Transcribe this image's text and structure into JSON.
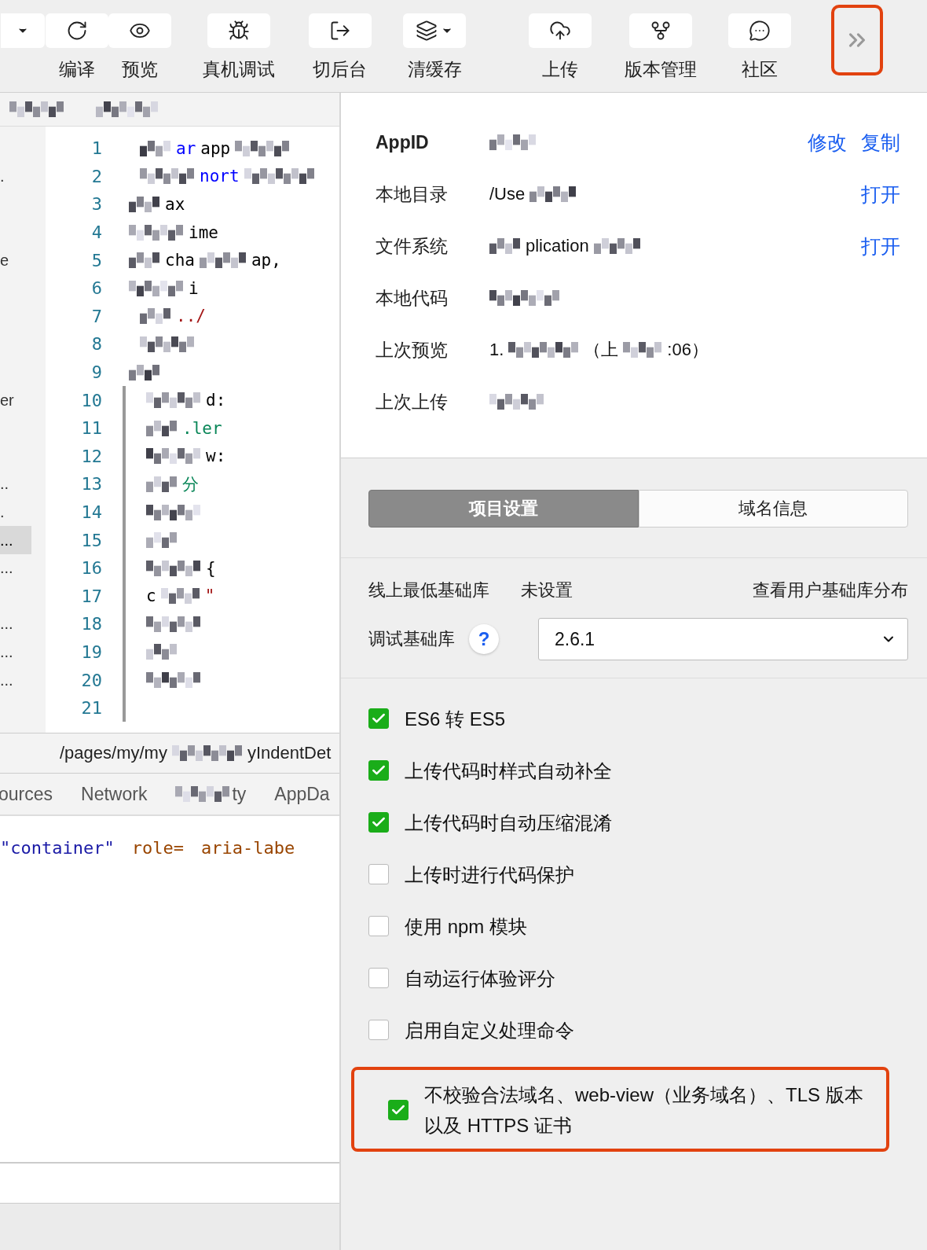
{
  "toolbar": {
    "buttons": [
      {
        "kind": "dropdown"
      },
      {
        "kind": "action",
        "label": "编译"
      },
      {
        "kind": "action",
        "label": "预览"
      },
      {
        "kind": "action",
        "label": "真机调试"
      },
      {
        "kind": "action",
        "label": "切后台"
      },
      {
        "kind": "action",
        "label": "清缓存"
      },
      {
        "kind": "action",
        "label": "上传"
      },
      {
        "kind": "action",
        "label": "版本管理"
      },
      {
        "kind": "action",
        "label": "社区"
      }
    ],
    "more": {
      "highlighted": true
    }
  },
  "editor": {
    "header": [
      {
        "kind": "mosaic"
      },
      {
        "kind": "mosaic"
      }
    ],
    "lines": [
      {
        "number": "1",
        "fragments": [
          {
            "kind": "mosaic"
          },
          {
            "kind": "text",
            "text": "ar",
            "color": "#0000ff"
          },
          {
            "kind": "text",
            "text": "app",
            "color": "#000000"
          },
          {
            "kind": "mosaic"
          }
        ]
      },
      {
        "number": "2",
        "fragments": [
          {
            "kind": "mosaic"
          },
          {
            "kind": "text",
            "text": "nort",
            "color": "#0000ff"
          },
          {
            "kind": "mosaic"
          }
        ],
        "sidebar": {
          "text": ".",
          "selected": false
        }
      },
      {
        "number": "3",
        "indent": true,
        "fragments": [
          {
            "kind": "mosaic"
          },
          {
            "kind": "text",
            "text": "ax",
            "color": "#000000"
          }
        ]
      },
      {
        "number": "4",
        "indent": true,
        "fragments": [
          {
            "kind": "mosaic"
          },
          {
            "kind": "text",
            "text": "ime",
            "color": "#000000"
          }
        ]
      },
      {
        "number": "5",
        "indent": true,
        "fragments": [
          {
            "kind": "mosaic"
          },
          {
            "kind": "text",
            "text": "cha",
            "color": "#000000"
          },
          {
            "kind": "mosaic"
          },
          {
            "kind": "text",
            "text": "ap,",
            "color": "#000000"
          }
        ],
        "sidebar": {
          "text": "e",
          "selected": false
        }
      },
      {
        "number": "6",
        "indent": true,
        "fragments": [
          {
            "kind": "mosaic"
          },
          {
            "kind": "text",
            "text": "i",
            "color": "#000000"
          }
        ]
      },
      {
        "number": "7",
        "fragments": [
          {
            "kind": "mosaic"
          },
          {
            "kind": "text",
            "text": "../",
            "color": "#a31515"
          }
        ]
      },
      {
        "number": "8",
        "fragments": [
          {
            "kind": "mosaic"
          }
        ]
      },
      {
        "number": "9",
        "indent": true,
        "fragments": [
          {
            "kind": "mosaic"
          }
        ]
      },
      {
        "number": "10",
        "indent": true,
        "nested": true,
        "fragments": [
          {
            "kind": "mosaic"
          },
          {
            "kind": "text",
            "text": "d:",
            "color": "#000000"
          }
        ],
        "sidebar": {
          "text": "er",
          "selected": false
        }
      },
      {
        "number": "11",
        "indent": true,
        "nested": true,
        "fragments": [
          {
            "kind": "mosaic"
          },
          {
            "kind": "text",
            "text": ".ler",
            "color": "#098658"
          }
        ]
      },
      {
        "number": "12",
        "indent": true,
        "nested": true,
        "fragments": [
          {
            "kind": "mosaic"
          },
          {
            "kind": "text",
            "text": "w:",
            "color": "#000000"
          }
        ]
      },
      {
        "number": "13",
        "indent": true,
        "nested": true,
        "fragments": [
          {
            "kind": "mosaic"
          },
          {
            "kind": "text",
            "text": "分",
            "color": "#098658"
          }
        ],
        "sidebar": {
          "text": "..",
          "selected": false
        }
      },
      {
        "number": "14",
        "indent": true,
        "nested": true,
        "fragments": [
          {
            "kind": "mosaic"
          }
        ],
        "sidebar": {
          "text": ".",
          "selected": false
        }
      },
      {
        "number": "15",
        "indent": true,
        "nested": true,
        "fragments": [
          {
            "kind": "mosaic"
          }
        ],
        "sidebar": {
          "text": "...",
          "selected": true
        }
      },
      {
        "number": "16",
        "indent": true,
        "nested": true,
        "fragments": [
          {
            "kind": "mosaic"
          },
          {
            "kind": "text",
            "text": "{",
            "color": "#000000"
          }
        ],
        "sidebar": {
          "text": "...",
          "selected": false
        }
      },
      {
        "number": "17",
        "indent": true,
        "nested": true,
        "fragments": [
          {
            "kind": "text",
            "text": "c",
            "color": "#000000"
          },
          {
            "kind": "mosaic"
          },
          {
            "kind": "text",
            "text": "\"",
            "color": "#a31515"
          }
        ]
      },
      {
        "number": "18",
        "indent": true,
        "nested": true,
        "fragments": [
          {
            "kind": "mosaic"
          }
        ],
        "sidebar": {
          "text": "...",
          "selected": false
        }
      },
      {
        "number": "19",
        "indent": true,
        "nested": true,
        "fragments": [
          {
            "kind": "mosaic"
          }
        ],
        "sidebar": {
          "text": "...",
          "selected": false
        }
      },
      {
        "number": "20",
        "indent": true,
        "nested": true,
        "fragments": [
          {
            "kind": "mosaic"
          }
        ],
        "sidebar": {
          "text": "...",
          "selected": false
        }
      },
      {
        "number": "21",
        "nested": true
      }
    ]
  },
  "path_bar": {
    "start": "/pages/my/my",
    "end": "yIndentDet"
  },
  "devtools_tabs": [
    {
      "label": "ources"
    },
    {
      "label": "Network"
    },
    {
      "label": "ty",
      "redacted": true
    },
    {
      "label": "AppDa"
    }
  ],
  "devtools_code": [
    {
      "text": "\"container\"",
      "color": "#1a1aa6"
    },
    {
      "text": "role=",
      "color": "#994500"
    },
    {
      "text": "aria-labe",
      "color": "#994500"
    }
  ],
  "project_info": [
    {
      "label": "AppID",
      "values": [
        {
          "kind": "mosaic"
        }
      ],
      "actions": [
        "修改",
        "复制"
      ]
    },
    {
      "label": "本地目录",
      "values": [
        {
          "kind": "text",
          "text": "/Use"
        },
        {
          "kind": "mosaic"
        }
      ],
      "actions": [
        "打开"
      ]
    },
    {
      "label": "文件系统",
      "values": [
        {
          "kind": "mosaic"
        },
        {
          "kind": "text",
          "text": "plication"
        },
        {
          "kind": "mosaic"
        }
      ],
      "actions": [
        "打开"
      ]
    },
    {
      "label": "本地代码",
      "values": [
        {
          "kind": "mosaic"
        }
      ]
    },
    {
      "label": "上次预览",
      "values": [
        {
          "kind": "text",
          "text": "1."
        },
        {
          "kind": "mosaic"
        },
        {
          "kind": "text",
          "text": "（上"
        },
        {
          "kind": "mosaic"
        },
        {
          "kind": "text",
          "text": ":06）"
        }
      ]
    },
    {
      "label": "上次上传",
      "values": [
        {
          "kind": "mosaic"
        }
      ]
    }
  ],
  "tabs": [
    {
      "label": "项目设置",
      "selected": true
    },
    {
      "label": "域名信息",
      "selected": false
    }
  ],
  "library": {
    "min_label": "线上最低基础库",
    "min_value": "未设置",
    "distribution_link": "查看用户基础库分布",
    "debug_label": "调试基础库",
    "help": "?",
    "debug_value": "2.6.1"
  },
  "options": [
    {
      "label": "ES6 转 ES5",
      "checked": true
    },
    {
      "label": "上传代码时样式自动补全",
      "checked": true
    },
    {
      "label": "上传代码时自动压缩混淆",
      "checked": true
    },
    {
      "label": "上传时进行代码保护",
      "checked": false
    },
    {
      "label": "使用 npm 模块",
      "checked": false
    },
    {
      "label": "自动运行体验评分",
      "checked": false
    },
    {
      "label": "启用自定义处理命令",
      "checked": false
    },
    {
      "label": "不校验合法域名、web-view（业务域名）、TLS 版本以及 HTTPS 证书",
      "checked": true,
      "highlighted": true
    }
  ]
}
